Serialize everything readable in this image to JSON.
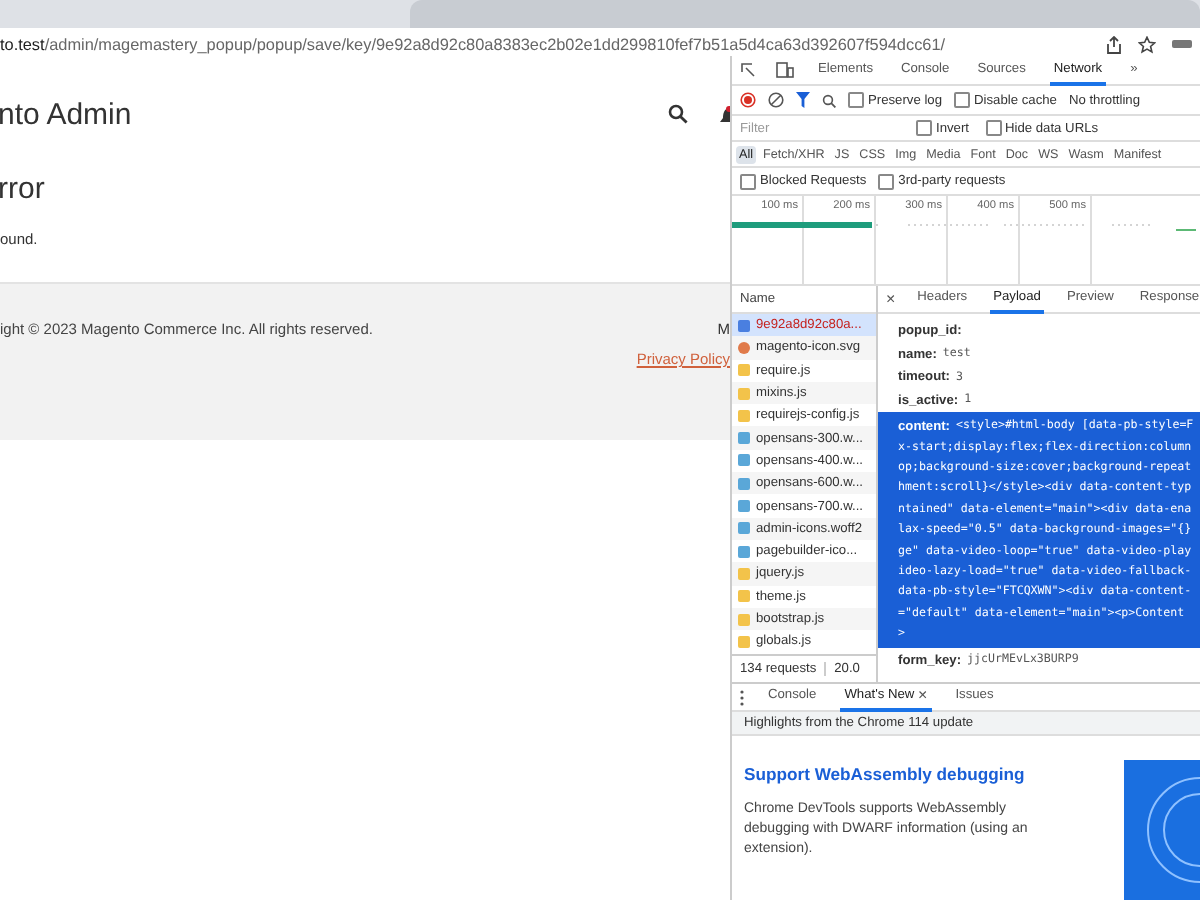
{
  "browser": {
    "url_host": "to.test",
    "url_path": "/admin/magemastery_popup/popup/save/key/9e92a8d92c80a8383ec2b02e1dd299810fef7b51a5d4ca63d392607f594dcc61/"
  },
  "page": {
    "header_title": "nto Admin",
    "error_title": "rror",
    "error_message": "ound.",
    "copyright": "ight © 2023 Magento Commerce Inc. All rights reserved.",
    "footer_letter": "M",
    "privacy_link": "Privacy Policy"
  },
  "devtools": {
    "tabs": [
      {
        "label": "Elements",
        "selected": false
      },
      {
        "label": "Console",
        "selected": false
      },
      {
        "label": "Sources",
        "selected": false
      },
      {
        "label": "Network",
        "selected": true
      },
      {
        "label": "»",
        "selected": false
      }
    ],
    "toolbar": {
      "recording": true,
      "options": [
        {
          "label": "Preserve log",
          "checked": false
        },
        {
          "label": "Disable cache",
          "checked": false
        }
      ],
      "throttling": "No throttling"
    },
    "filter": {
      "placeholder": "Filter",
      "options": [
        {
          "label": "Invert",
          "checked": false
        },
        {
          "label": "Hide data URLs",
          "checked": false
        }
      ]
    },
    "types": [
      {
        "label": "All",
        "selected": true
      },
      {
        "label": "Fetch/XHR",
        "selected": false
      },
      {
        "label": "JS",
        "selected": false
      },
      {
        "label": "CSS",
        "selected": false
      },
      {
        "label": "Img",
        "selected": false
      },
      {
        "label": "Media",
        "selected": false
      },
      {
        "label": "Font",
        "selected": false
      },
      {
        "label": "Doc",
        "selected": false
      },
      {
        "label": "WS",
        "selected": false
      },
      {
        "label": "Wasm",
        "selected": false
      },
      {
        "label": "Manifest",
        "selected": false
      }
    ],
    "request_options": [
      {
        "label": "Blocked Requests",
        "checked": false
      },
      {
        "label": "3rd-party requests",
        "checked": false
      }
    ],
    "timeline_ticks": [
      "100 ms",
      "200 ms",
      "300 ms",
      "400 ms",
      "500 ms"
    ],
    "name_header": "Name",
    "requests": [
      {
        "name": "9e92a8d92c80a...",
        "kind": "document",
        "selected": true
      },
      {
        "name": "magento-icon.svg",
        "kind": "image",
        "selected": false
      },
      {
        "name": "require.js",
        "kind": "script",
        "selected": false
      },
      {
        "name": "mixins.js",
        "kind": "script",
        "selected": false
      },
      {
        "name": "requirejs-config.js",
        "kind": "script",
        "selected": false
      },
      {
        "name": "opensans-300.w...",
        "kind": "font",
        "selected": false
      },
      {
        "name": "opensans-400.w...",
        "kind": "font",
        "selected": false
      },
      {
        "name": "opensans-600.w...",
        "kind": "font",
        "selected": false
      },
      {
        "name": "opensans-700.w...",
        "kind": "font",
        "selected": false
      },
      {
        "name": "admin-icons.woff2",
        "kind": "font",
        "selected": false
      },
      {
        "name": "pagebuilder-ico...",
        "kind": "font",
        "selected": false
      },
      {
        "name": "jquery.js",
        "kind": "script",
        "selected": false
      },
      {
        "name": "theme.js",
        "kind": "script",
        "selected": false
      },
      {
        "name": "bootstrap.js",
        "kind": "script",
        "selected": false
      },
      {
        "name": "globals.js",
        "kind": "script",
        "selected": false
      }
    ],
    "status": [
      "134 requests",
      "20.0"
    ],
    "detail_close": "×",
    "detail_tabs": [
      {
        "label": "Headers",
        "selected": false
      },
      {
        "label": "Payload",
        "selected": true
      },
      {
        "label": "Preview",
        "selected": false
      },
      {
        "label": "Response",
        "selected": false
      }
    ],
    "payload": [
      {
        "key": "popup_id:",
        "highlighted": false
      },
      {
        "key": "name:",
        "value": "test",
        "highlighted": false
      },
      {
        "key": "timeout:",
        "value": "3",
        "highlighted": false
      },
      {
        "key": "is_active:",
        "value": "1",
        "highlighted": false
      },
      {
        "key": "content:",
        "value": "<style>#html-body [data-pb-style=F",
        "highlighted": true,
        "more_lines": [
          "x-start;display:flex;flex-direction:column",
          "op;background-size:cover;background-repeat",
          "hment:scroll}</style><div data-content-typ",
          "ntained\" data-element=\"main\"><div data-ena",
          "lax-speed=\"0.5\" data-background-images=\"{}",
          "ge\" data-video-loop=\"true\" data-video-play",
          "ideo-lazy-load=\"true\" data-video-fallback-",
          "data-pb-style=\"FTCQXWN\"><div data-content-",
          "=\"default\" data-element=\"main\"><p>Content",
          ">"
        ]
      },
      {
        "key": "form_key:",
        "value": "jjcUrMEvLx3BURP9",
        "highlighted": false
      }
    ]
  },
  "drawer": {
    "tabs": [
      {
        "label": "Console",
        "selected": false
      },
      {
        "label": "What's New",
        "selected": true,
        "close_label": "×"
      },
      {
        "label": "Issues",
        "selected": false
      }
    ],
    "banner": "Highlights from the Chrome 114 update",
    "title": "Support WebAssembly debugging",
    "body": "Chrome DevTools supports WebAssembly debugging with DWARF information (using an extension)."
  }
}
